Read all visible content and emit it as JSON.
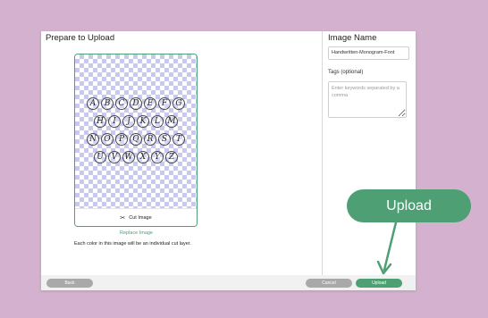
{
  "dialog": {
    "title": "Prepare to Upload",
    "preview": {
      "letter_rows": [
        [
          "A",
          "B",
          "C",
          "D",
          "E",
          "F",
          "G"
        ],
        [
          "H",
          "I",
          "J",
          "K",
          "L",
          "M"
        ],
        [
          "N",
          "O",
          "P",
          "Q",
          "R",
          "S",
          "T"
        ],
        [
          "U",
          "V",
          "W",
          "X",
          "Y",
          "Z"
        ]
      ],
      "cut_label": "Cut Image"
    },
    "replace_label": "Replace Image",
    "info_text": "Each color in this image will be an individual cut layer."
  },
  "sidebar": {
    "image_name_label": "Image Name",
    "image_name_value": "Handwritten-Monogram-Font",
    "tags_label": "Tags (optional)",
    "tags_placeholder": "Enter keywords separated by a comma"
  },
  "footer": {
    "back_label": "Back",
    "cancel_label": "Cancel",
    "upload_label": "Upload"
  },
  "callout": {
    "label": "Upload"
  },
  "colors": {
    "background": "#d4b2cf",
    "accent": "#4e9f73",
    "button_gray": "#a9a9a9",
    "checker": "#c9c9ee"
  },
  "icons": [
    "scissors-icon",
    "arrow-icon"
  ]
}
